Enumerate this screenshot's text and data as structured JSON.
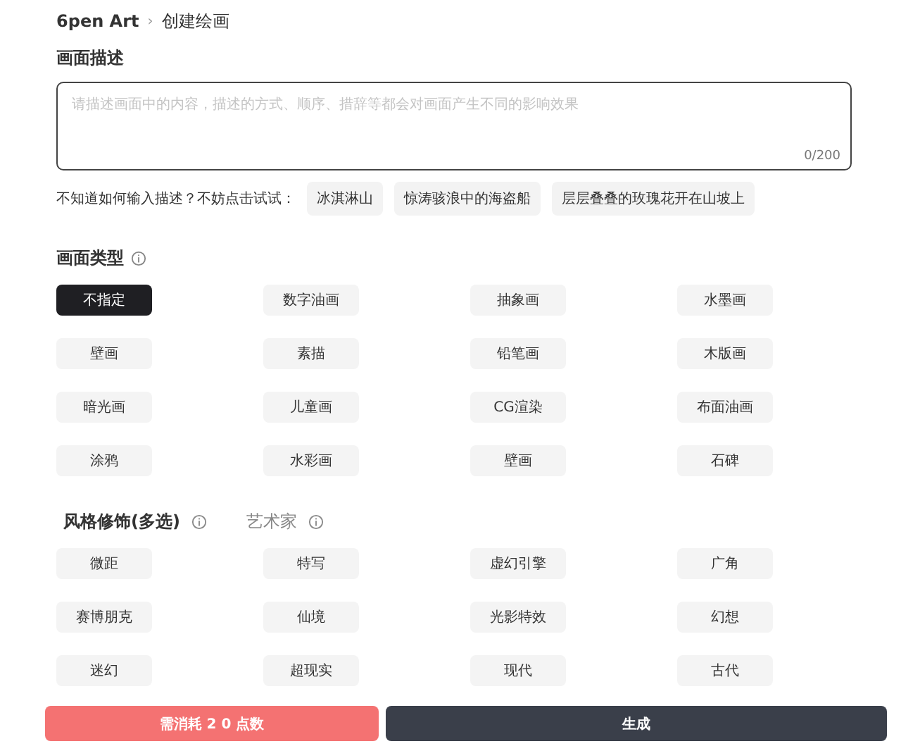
{
  "breadcrumb": {
    "root": "6pen Art",
    "separator": "›",
    "current": "创建绘画"
  },
  "description": {
    "label": "画面描述",
    "placeholder": "请描述画面中的内容，描述的方式、顺序、措辞等都会对画面产生不同的影响效果",
    "counter": "0/200"
  },
  "suggestions": {
    "prompt": "不知道如何输入描述？不妨点击试试：",
    "items": [
      "冰淇淋山",
      "惊涛骇浪中的海盗船",
      "层层叠叠的玫瑰花开在山坡上"
    ]
  },
  "picture_type": {
    "label": "画面类型",
    "options": [
      {
        "label": "不指定",
        "selected": true
      },
      {
        "label": "数字油画",
        "selected": false
      },
      {
        "label": "抽象画",
        "selected": false
      },
      {
        "label": "水墨画",
        "selected": false
      },
      {
        "label": "壁画",
        "selected": false
      },
      {
        "label": "素描",
        "selected": false
      },
      {
        "label": "铅笔画",
        "selected": false
      },
      {
        "label": "木版画",
        "selected": false
      },
      {
        "label": "暗光画",
        "selected": false
      },
      {
        "label": "儿童画",
        "selected": false
      },
      {
        "label": "CG渲染",
        "selected": false
      },
      {
        "label": "布面油画",
        "selected": false
      },
      {
        "label": "涂鸦",
        "selected": false
      },
      {
        "label": "水彩画",
        "selected": false
      },
      {
        "label": "壁画",
        "selected": false
      },
      {
        "label": "石碑",
        "selected": false
      }
    ]
  },
  "style_tabs": [
    {
      "label": "风格修饰(多选)",
      "selected": true
    },
    {
      "label": "艺术家",
      "selected": false
    }
  ],
  "style_options": [
    {
      "label": "微距",
      "selected": false
    },
    {
      "label": "特写",
      "selected": false
    },
    {
      "label": "虚幻引擎",
      "selected": false
    },
    {
      "label": "广角",
      "selected": false
    },
    {
      "label": "赛博朋克",
      "selected": false
    },
    {
      "label": "仙境",
      "selected": false
    },
    {
      "label": "光影特效",
      "selected": false
    },
    {
      "label": "幻想",
      "selected": false
    },
    {
      "label": "迷幻",
      "selected": false
    },
    {
      "label": "超现实",
      "selected": false
    },
    {
      "label": "现代",
      "selected": false
    },
    {
      "label": "古代",
      "selected": false
    }
  ],
  "actions": {
    "cost": "需消耗 2 0 点数",
    "generate": "生成"
  }
}
